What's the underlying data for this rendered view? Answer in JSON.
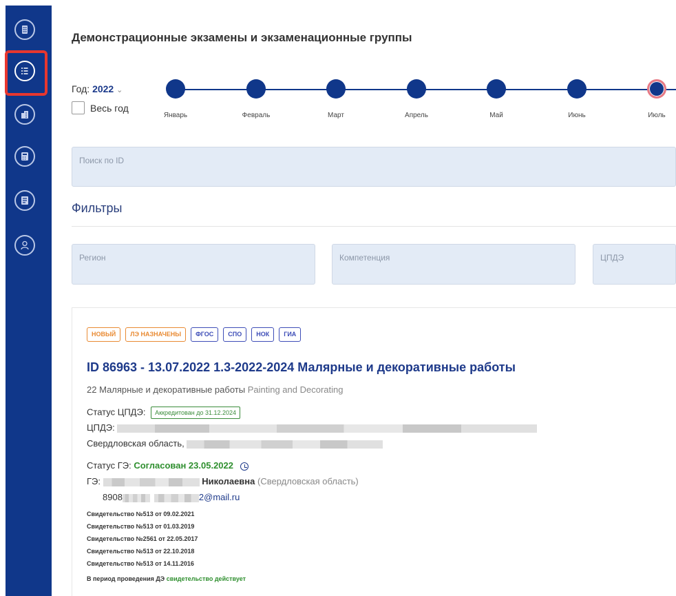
{
  "sidebar": {
    "items": [
      {
        "icon": "document-icon"
      },
      {
        "icon": "list-icon",
        "active": true
      },
      {
        "icon": "building-icon"
      },
      {
        "icon": "calculator-icon"
      },
      {
        "icon": "clipboard-icon"
      },
      {
        "icon": "user-icon"
      }
    ]
  },
  "header": {
    "title": "Демонстрационные экзамены и экзаменационные группы",
    "year_label": "Год:",
    "year_value": "2022",
    "all_year": "Весь год"
  },
  "timeline": {
    "months": [
      "Январь",
      "Февраль",
      "Март",
      "Апрель",
      "Май",
      "Июнь",
      "Июль"
    ],
    "selected_month": "Июль"
  },
  "search": {
    "placeholder": "Поиск по ID"
  },
  "filters": {
    "title": "Фильтры",
    "region": "Регион",
    "competence": "Компетенция",
    "cpde": "ЦПДЭ"
  },
  "card": {
    "tags": [
      {
        "label": "НОВЫЙ",
        "color": "#e98a32"
      },
      {
        "label": "ЛЭ НАЗНАЧЕНЫ",
        "color": "#e98a32"
      },
      {
        "label": "ФГОС",
        "color": "#3d4db7"
      },
      {
        "label": "СПО",
        "color": "#3d4db7"
      },
      {
        "label": "НОК",
        "color": "#3d4db7"
      },
      {
        "label": "ГИА",
        "color": "#3d4db7"
      }
    ],
    "title": "ID 86963 - 13.07.2022 1.3-2022-2024 Малярные и декоративные работы",
    "competence_number": "22",
    "competence_ru": "Малярные и декоративные работы",
    "competence_en": "Painting and Decorating",
    "status_cpde_label": "Статус ЦПДЭ:",
    "status_cpde_value": "Аккредитован до 31.12.2024",
    "cpde_label": "ЦПДЭ:",
    "region": "Свердловская область,",
    "status_ge_label": "Статус ГЭ:",
    "status_ge_value": "Согласован 23.05.2022",
    "ge_label": "ГЭ:",
    "ge_name": "Николаевна",
    "ge_region": "(Свердловская область)",
    "phone_prefix": "8908",
    "email_suffix": "2@mail.ru",
    "certificates": [
      "Свидетельство №513 от 09.02.2021",
      "Свидетельство №513 от 01.03.2019",
      "Свидетельство №2561 от 22.05.2017",
      "Свидетельство №513 от 22.10.2018",
      "Свидетельство №513 от 14.11.2016"
    ],
    "period_text": "В период проведения ДЭ",
    "period_status": "свидетельство действует"
  },
  "colors": {
    "sidebar": "#10378a",
    "accent": "#1e3a8a",
    "highlight": "#e8372f"
  }
}
